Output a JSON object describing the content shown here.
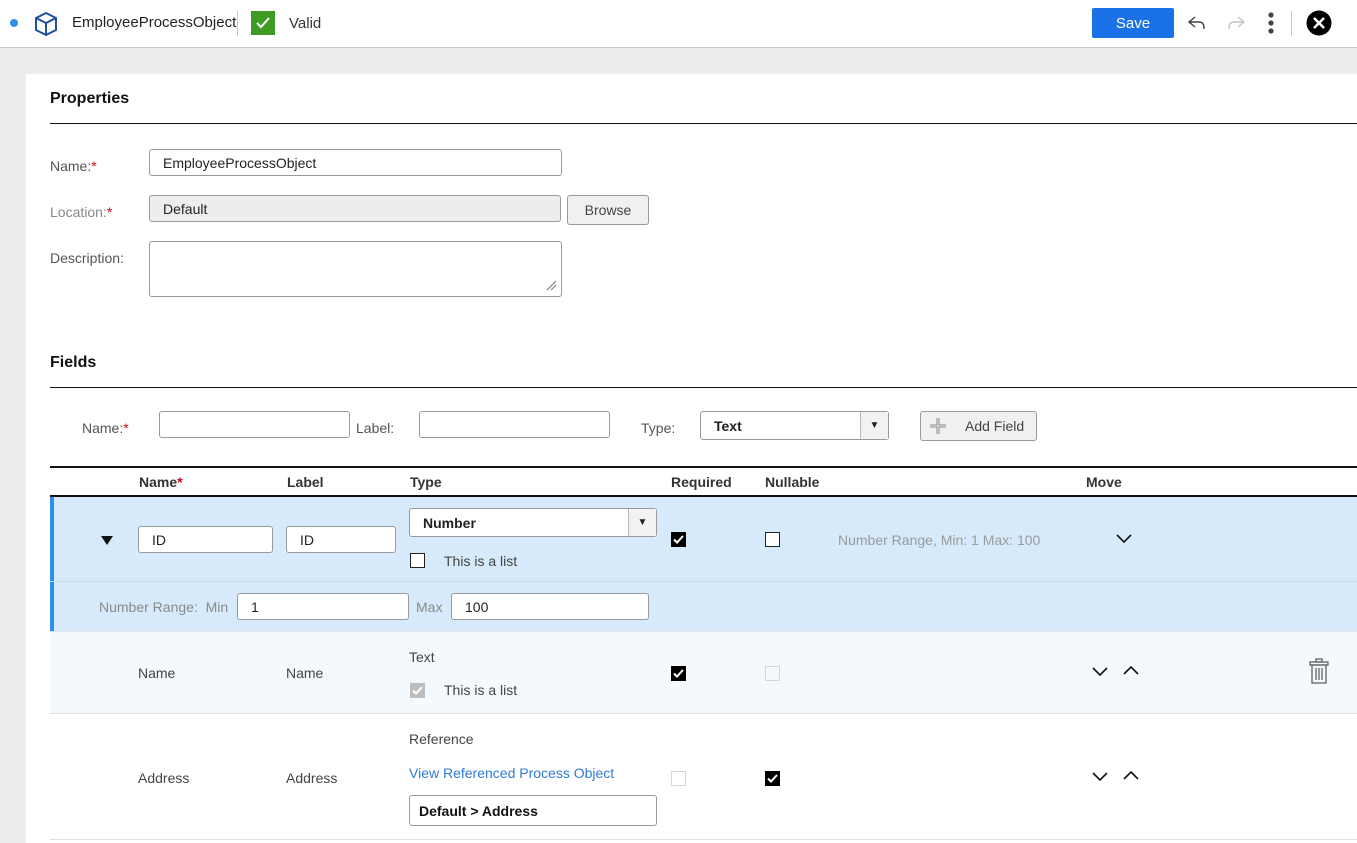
{
  "header": {
    "title": "EmployeeProcessObject",
    "status": "Valid",
    "save_label": "Save",
    "colors": {
      "accent": "#1b72e8",
      "valid": "#3f9b24",
      "unsaved_dot": "#2f8fe8"
    }
  },
  "properties": {
    "section_title": "Properties",
    "name_label": "Name:",
    "name_value": "EmployeeProcessObject",
    "location_label": "Location:",
    "location_value": "Default",
    "browse_label": "Browse",
    "description_label": "Description:",
    "description_value": "",
    "required_mark": "*"
  },
  "fields": {
    "section_title": "Fields",
    "add_form": {
      "name_label": "Name:",
      "name_value": "",
      "label_label": "Label:",
      "label_value": "",
      "type_label": "Type:",
      "type_value": "Text",
      "add_button": "Add Field"
    },
    "columns": [
      "Name",
      "Label",
      "Type",
      "Required",
      "Nullable",
      "Move"
    ],
    "rows": [
      {
        "name": "ID",
        "label": "ID",
        "type": "Number",
        "is_list_label": "This is a list",
        "is_list": false,
        "required": true,
        "nullable": false,
        "summary": "Number Range, Min: 1 Max: 100",
        "range_label": "Number Range:",
        "min_label": "Min",
        "min_value": "1",
        "max_label": "Max",
        "max_value": "100"
      },
      {
        "name": "Name",
        "label": "Name",
        "type": "Text",
        "is_list_label": "This is a list",
        "is_list": true,
        "required": true,
        "nullable": false
      },
      {
        "name": "Address",
        "label": "Address",
        "type": "Reference",
        "link_label": "View Referenced Process Object",
        "reference_value": "Default > Address",
        "required": false,
        "nullable": true
      }
    ]
  }
}
